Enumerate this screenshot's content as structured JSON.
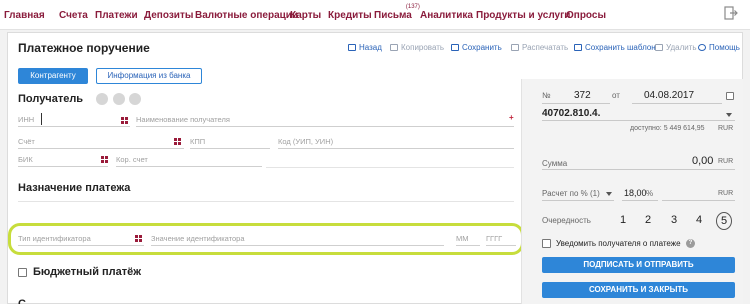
{
  "nav": {
    "items": [
      "Главная",
      "Счета",
      "Платежи",
      "Депозиты",
      "Валютные операции",
      "Карты",
      "Кредиты",
      "Письма",
      "Аналитика",
      "Продукты и услуги",
      "Опросы"
    ],
    "letters_count": "(137)",
    "exit_icon": "exit-icon"
  },
  "form": {
    "title": "Платежное поручение",
    "actions": {
      "back": "Назад",
      "copy": "Копировать",
      "save": "Сохранить",
      "print": "Распечатать",
      "save_template": "Сохранить шаблон",
      "delete": "Удалить",
      "help": "Помощь"
    },
    "tabs": {
      "counterparty": "Контрагенту",
      "bank_info": "Информация из банка"
    },
    "recipient": {
      "title": "Получатель",
      "inn": "ИНН",
      "name_placeholder": "Наименование получателя",
      "account": "Счёт",
      "kpp": "КПП",
      "uip": "Код (УИП, УИН)",
      "bik": "БИК",
      "corr_account": "Кор. счет"
    },
    "purpose": {
      "title": "Назначение платежа",
      "id_type": "Тип идентификатора",
      "id_value": "Значение идентификатора",
      "mm": "ММ",
      "yyyy": "ГГГГ"
    },
    "budget": "Бюджетный платёж",
    "next_section_partial": "С"
  },
  "side": {
    "number_label": "№",
    "number": "372",
    "from_label": "от",
    "date": "04.08.2017",
    "account": "40702.810.4.",
    "available": "доступно: 5 449 614,95",
    "currency": "RUR",
    "sum_label": "Сумма",
    "sum": "0,00",
    "vat_label": "Расчет по % (1)",
    "vat_rate": "18,00",
    "percent": "%",
    "priority_label": "Очередность",
    "priorities": [
      "1",
      "2",
      "3",
      "4",
      "5"
    ],
    "notify": "Уведомить получателя о платеже",
    "sign_send": "ПОДПИСАТЬ И ОТПРАВИТЬ",
    "save_close": "СОХРАНИТЬ И ЗАКРЫТЬ"
  },
  "colors": {
    "brand": "#8a1c3c",
    "accent": "#2e86d8",
    "highlight": "#c7dd3c"
  }
}
